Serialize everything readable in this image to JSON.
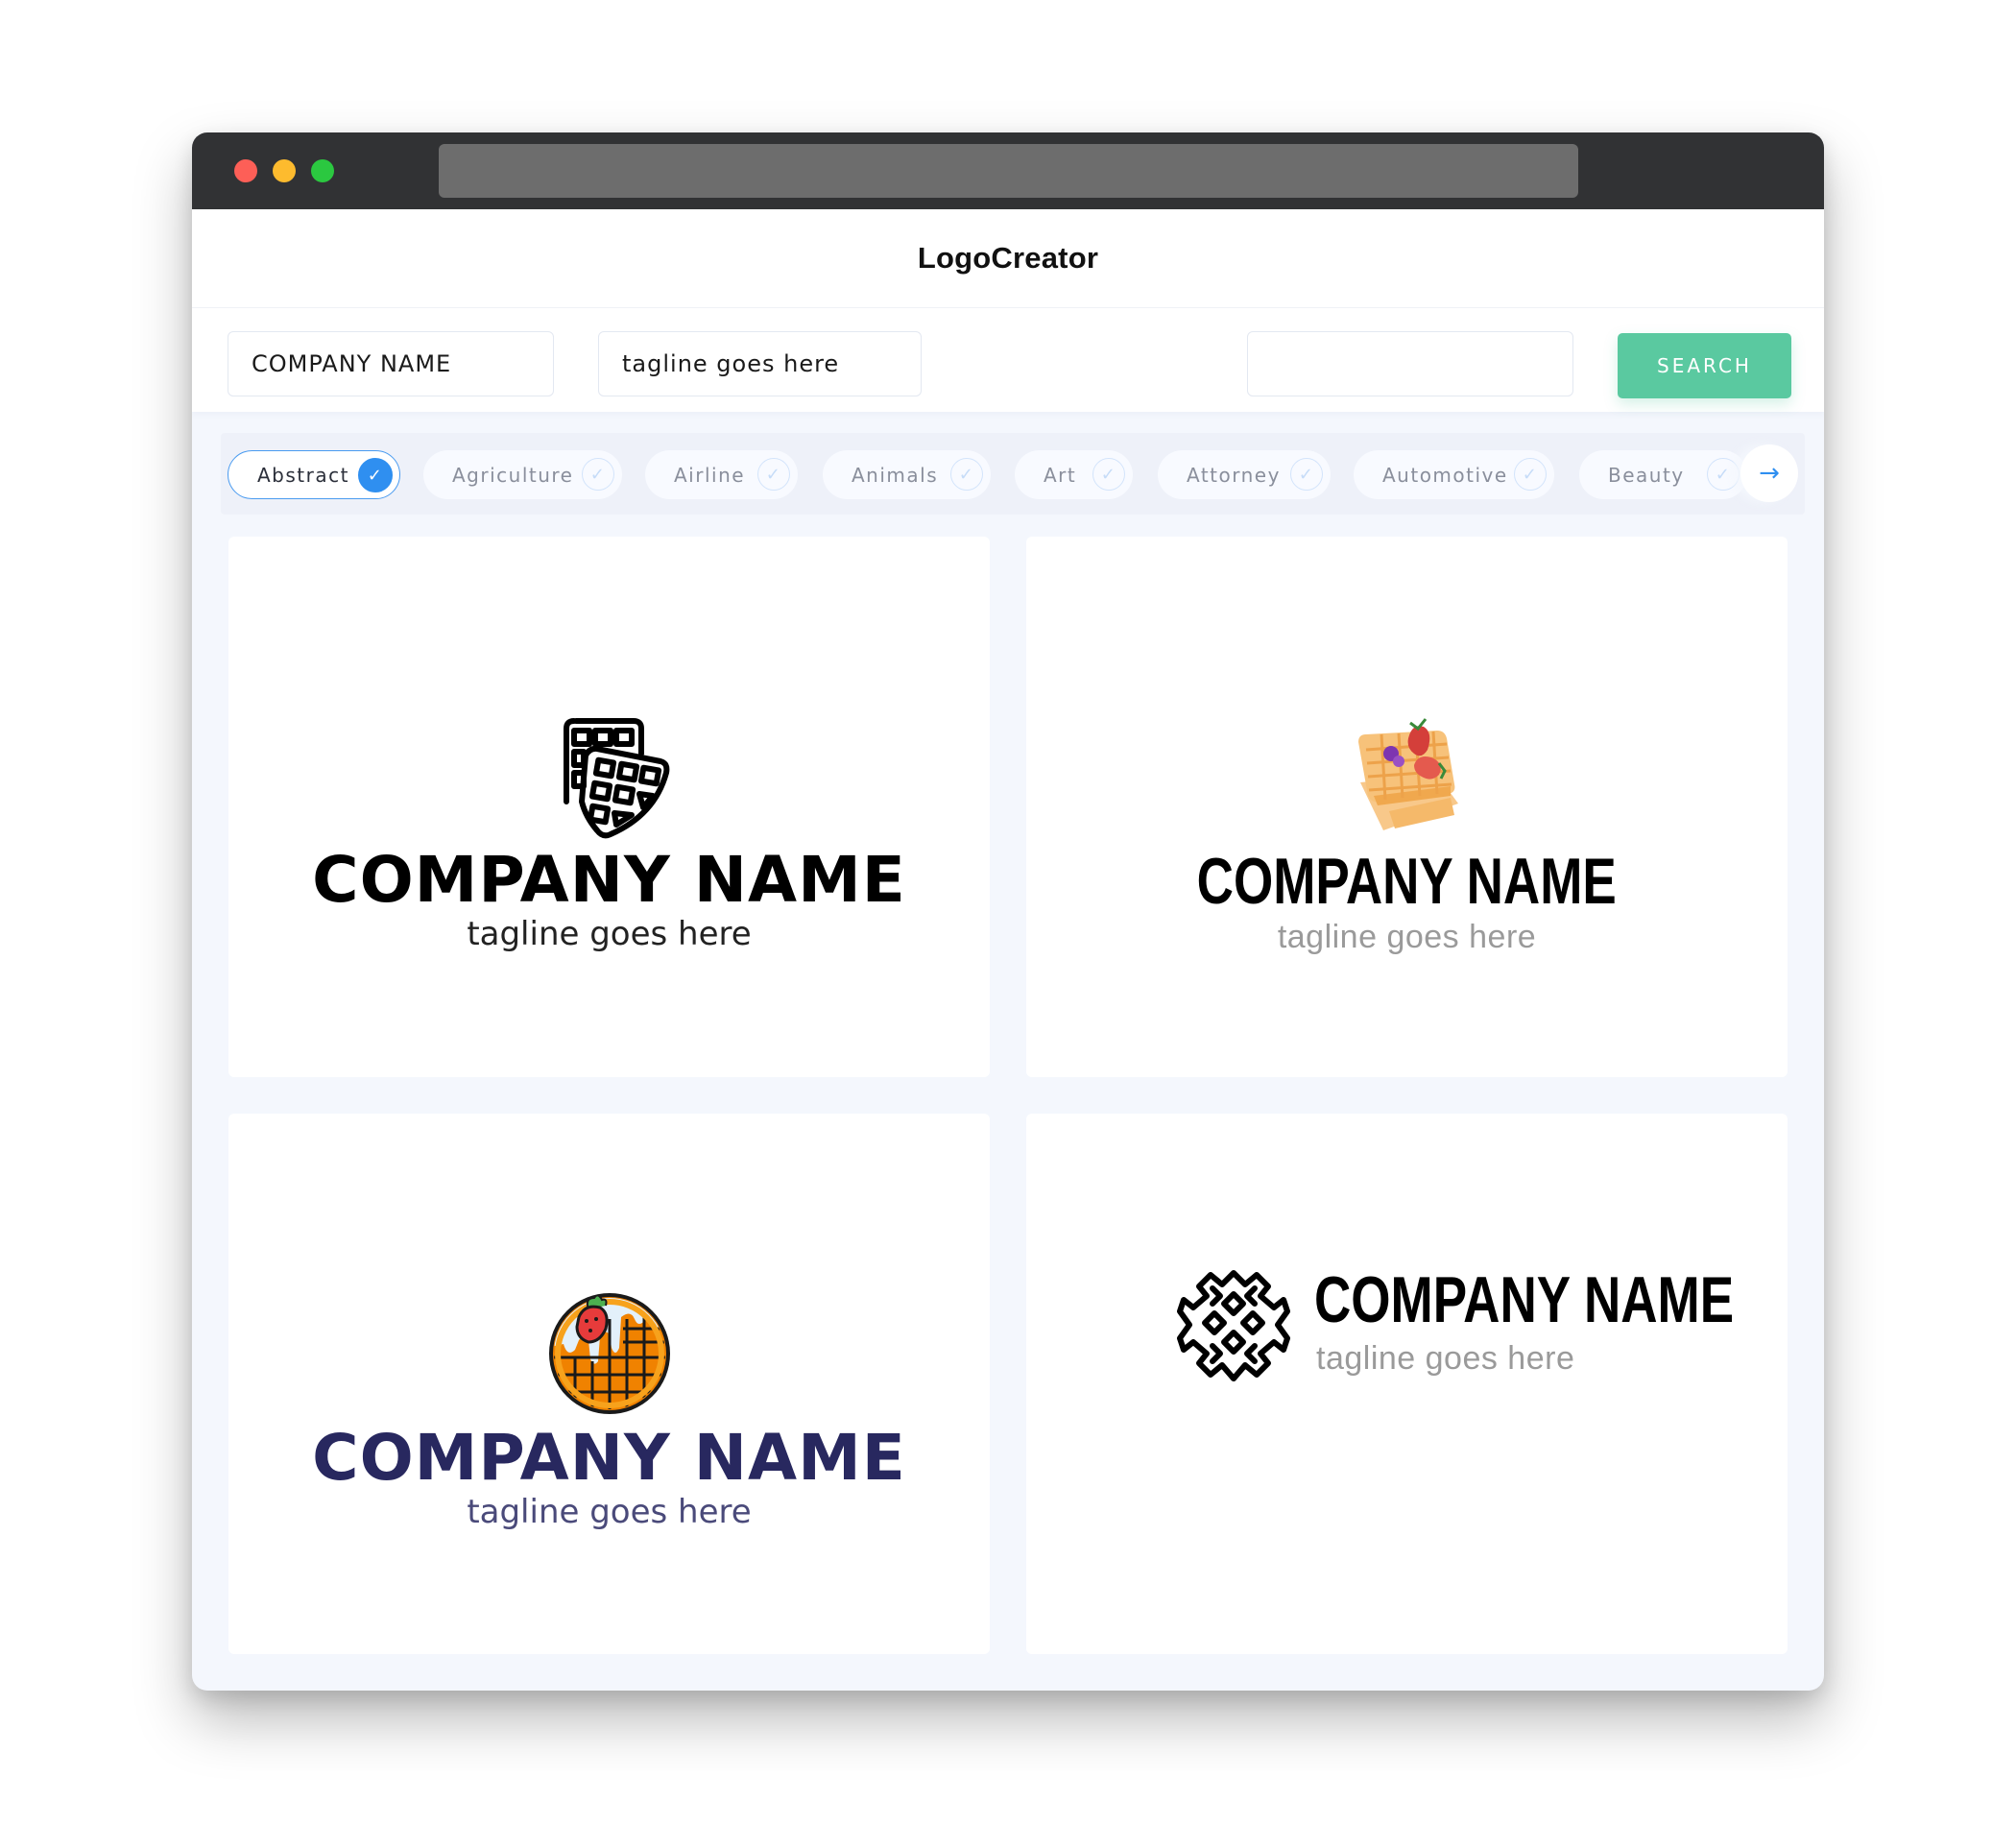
{
  "window": {
    "traffic_lights": [
      "close",
      "minimize",
      "maximize"
    ]
  },
  "header": {
    "title": "LogoCreator"
  },
  "toolbar": {
    "company_field": {
      "value": "COMPANY NAME",
      "placeholder": "COMPANY NAME"
    },
    "tagline_field": {
      "value": "tagline goes here",
      "placeholder": "tagline goes here"
    },
    "extra_field": {
      "value": "",
      "placeholder": ""
    },
    "search_label": "SEARCH"
  },
  "categories": {
    "items": [
      {
        "label": "Abstract",
        "selected": true
      },
      {
        "label": "Agriculture",
        "selected": false
      },
      {
        "label": "Airline",
        "selected": false
      },
      {
        "label": "Animals",
        "selected": false
      },
      {
        "label": "Art",
        "selected": false
      },
      {
        "label": "Attorney",
        "selected": false
      },
      {
        "label": "Automotive",
        "selected": false
      },
      {
        "label": "Beauty",
        "selected": false
      }
    ],
    "check_icon": "check-icon",
    "next_icon": "arrow-right-icon"
  },
  "logos": [
    {
      "icon": "waffle-outline-icon",
      "company": "COMPANY NAME",
      "tagline": "tagline goes here",
      "name_color": "#000000",
      "tagline_color": "#222222"
    },
    {
      "icon": "waffle-berries-icon",
      "company": "COMPANY NAME",
      "tagline": "tagline goes here",
      "name_color": "#000000",
      "tagline_color": "#9a9a9a"
    },
    {
      "icon": "round-waffle-strawberry-icon",
      "company": "COMPANY NAME",
      "tagline": "tagline goes here",
      "name_color": "#28285f",
      "tagline_color": "#4a4a7a"
    },
    {
      "icon": "waffle-lattice-icon",
      "company": "COMPANY NAME",
      "tagline": "tagline goes here",
      "name_color": "#000000",
      "tagline_color": "#9a9a9a"
    }
  ],
  "colors": {
    "accent": "#2f8ff0",
    "search_button": "#5ac9a0",
    "titlebar": "#313234",
    "page_bg": "#f4f7fd"
  }
}
